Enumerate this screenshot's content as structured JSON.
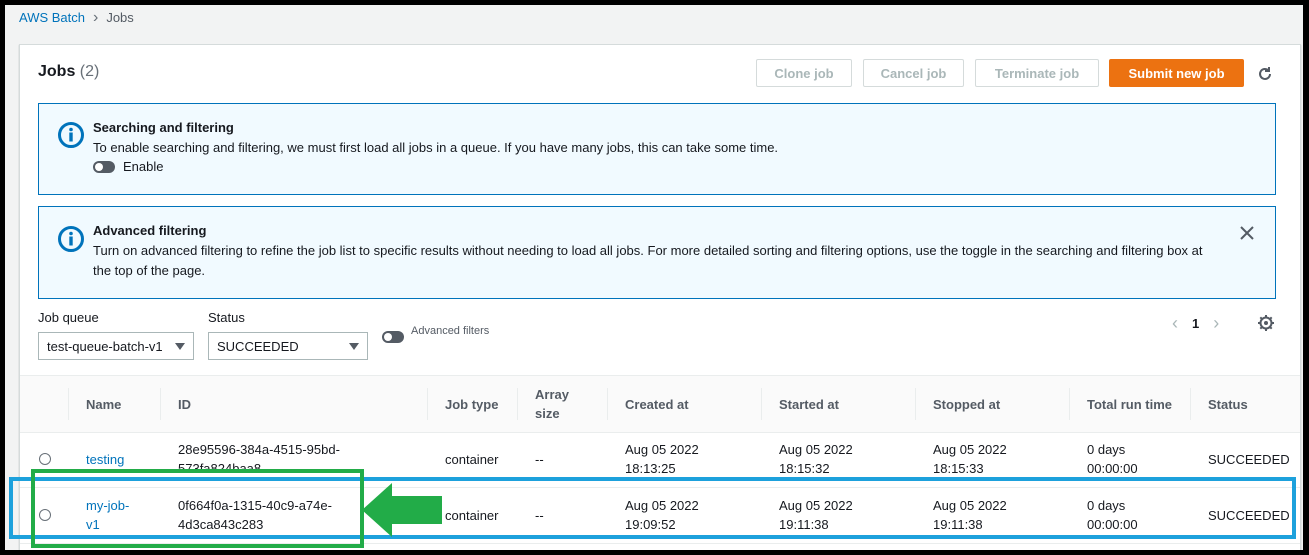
{
  "breadcrumb": {
    "root": "AWS Batch",
    "current": "Jobs"
  },
  "header": {
    "title": "Jobs",
    "count": "(2)"
  },
  "actions": {
    "clone": "Clone job",
    "cancel": "Cancel job",
    "terminate": "Terminate job",
    "submit": "Submit new job"
  },
  "alerts": {
    "search": {
      "title": "Searching and filtering",
      "text": "To enable searching and filtering, we must first load all jobs in a queue. If you have many jobs, this can take some time.",
      "toggle_label": "Enable"
    },
    "advanced": {
      "title": "Advanced filtering",
      "text_line1": "Turn on advanced filtering to refine the job list to specific results without needing to load all jobs. For more detailed sorting and filtering options, use the toggle in the searching and filtering box at",
      "text_line2": "the top of the page."
    }
  },
  "filters": {
    "queue_label": "Job queue",
    "queue_value": "test-queue-batch-v1",
    "status_label": "Status",
    "status_value": "SUCCEEDED",
    "advanced_label": "Advanced filters"
  },
  "pagination": {
    "page": "1"
  },
  "table": {
    "columns": {
      "name": "Name",
      "id": "ID",
      "job_type": "Job type",
      "array_size_1": "Array",
      "array_size_2": "size",
      "created": "Created at",
      "started": "Started at",
      "stopped": "Stopped at",
      "runtime": "Total run time",
      "status": "Status"
    },
    "rows": [
      {
        "name_1": "testing",
        "name_2": "",
        "id_1": "28e95596-384a-4515-95bd-",
        "id_2": "573fa824baa8",
        "job_type": "container",
        "array_size": "--",
        "created_1": "Aug 05 2022",
        "created_2": "18:13:25",
        "started_1": "Aug 05 2022",
        "started_2": "18:15:32",
        "stopped_1": "Aug 05 2022",
        "stopped_2": "18:15:33",
        "runtime_1": "0 days",
        "runtime_2": "00:00:00",
        "status": "SUCCEEDED"
      },
      {
        "name_1": "my-job-",
        "name_2": "v1",
        "id_1": "0f664f0a-1315-40c9-a74e-",
        "id_2": "4d3ca843c283",
        "job_type": "container",
        "array_size": "--",
        "created_1": "Aug 05 2022",
        "created_2": "19:09:52",
        "started_1": "Aug 05 2022",
        "started_2": "19:11:38",
        "stopped_1": "Aug 05 2022",
        "stopped_2": "19:11:38",
        "runtime_1": "0 days",
        "runtime_2": "00:00:00",
        "status": "SUCCEEDED"
      }
    ]
  },
  "colors": {
    "primary": "#ec7211",
    "link": "#0073bb",
    "highlight_blue": "#1da1dc",
    "highlight_green": "#22ac48"
  }
}
